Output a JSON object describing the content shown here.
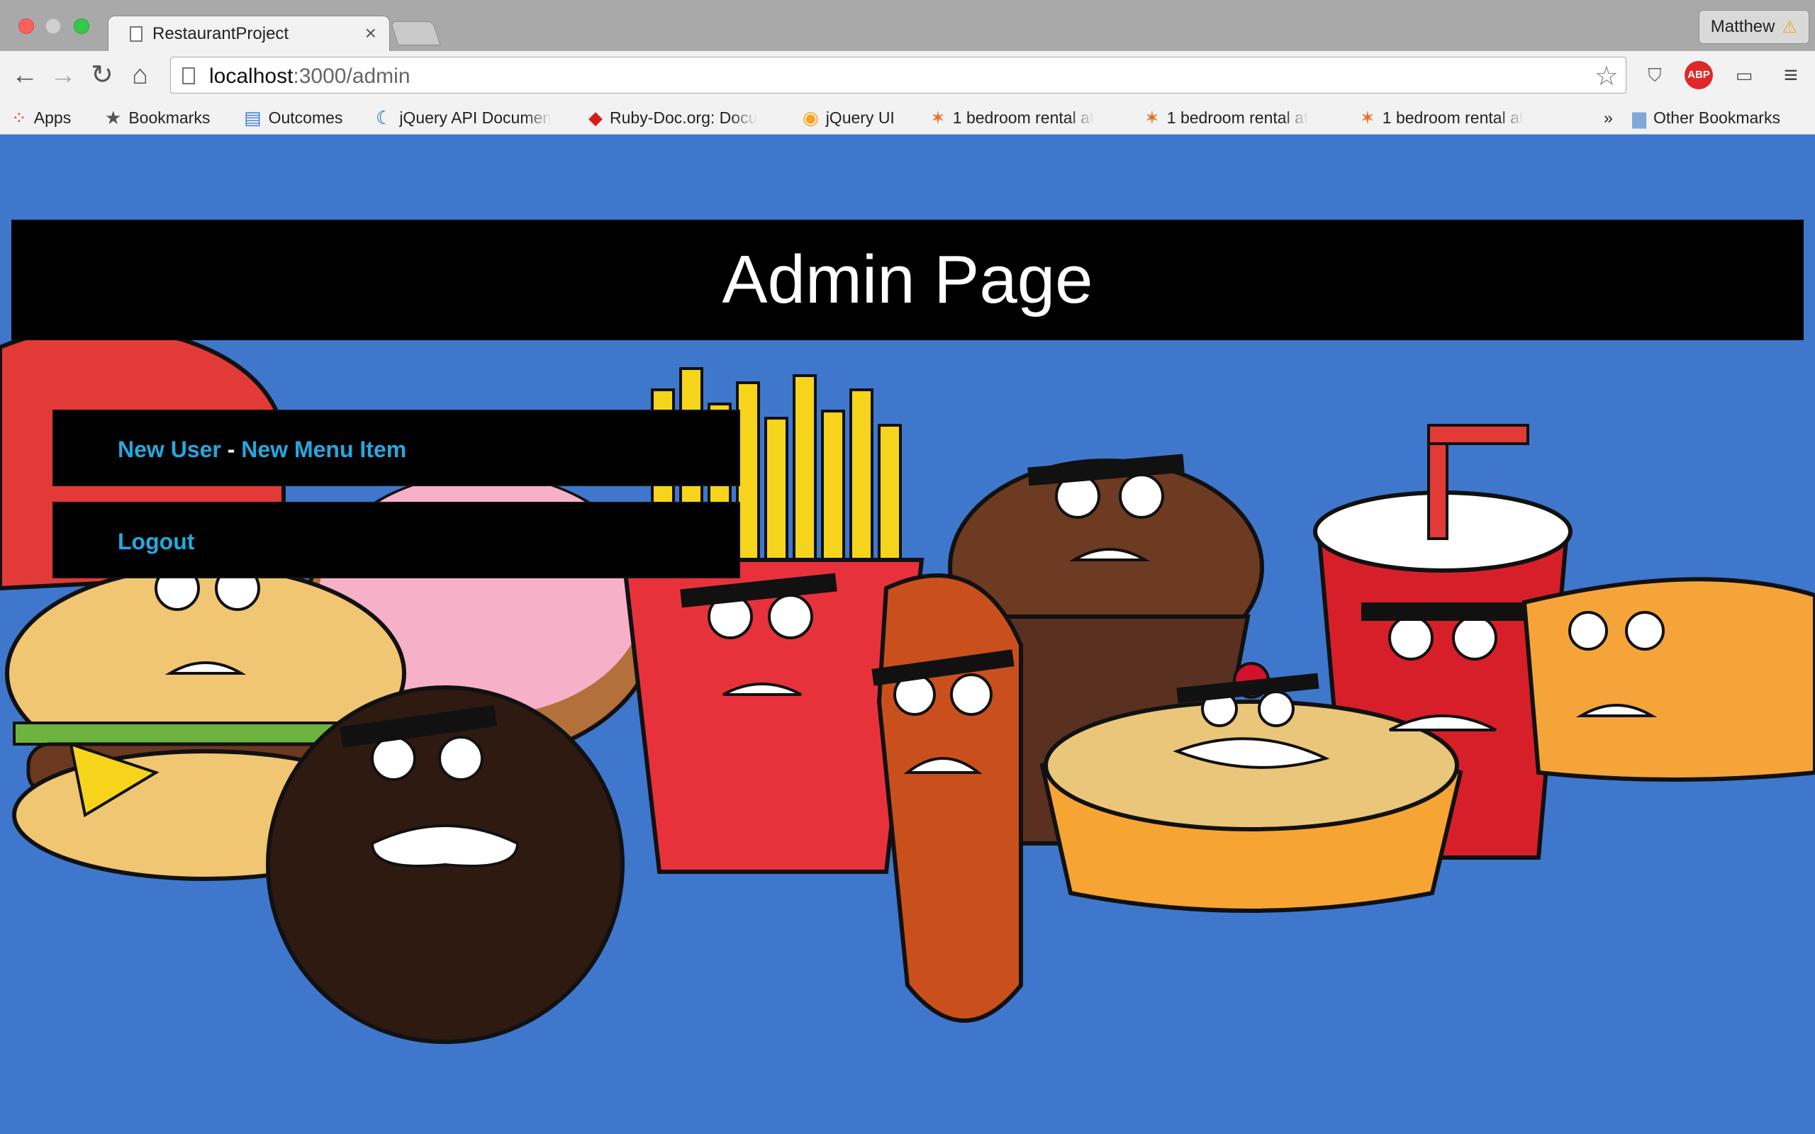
{
  "browser": {
    "tab_title": "RestaurantProject",
    "tab_close": "×",
    "profile_name": "Matthew",
    "profile_warning": "⚠",
    "url_host": "localhost",
    "url_path": ":3000/admin",
    "abp_label": "ABP",
    "bookmarks": [
      {
        "label": "Apps",
        "icon": "apps-grid-icon"
      },
      {
        "label": "Bookmarks",
        "icon": "star-icon"
      },
      {
        "label": "Outcomes",
        "icon": "docs-icon"
      },
      {
        "label": "jQuery API Documen",
        "icon": "jquery-icon"
      },
      {
        "label": "Ruby-Doc.org: Docu",
        "icon": "ruby-icon"
      },
      {
        "label": "jQuery UI",
        "icon": "jquery-ui-icon"
      },
      {
        "label": "1 bedroom rental at",
        "icon": "craigslist-star-icon"
      },
      {
        "label": "1 bedroom rental at",
        "icon": "craigslist-star-icon"
      },
      {
        "label": "1 bedroom rental at",
        "icon": "craigslist-star-icon"
      }
    ],
    "overflow": "»",
    "other_bookmarks": "Other Bookmarks"
  },
  "page": {
    "title": "Admin Page",
    "nav": {
      "new_user": "New User",
      "separator": " - ",
      "new_menu_item": "New Menu Item",
      "logout": "Logout"
    }
  },
  "colors": {
    "background": "#3f77cc",
    "link": "#25a8e0",
    "header_bg": "#000000"
  }
}
